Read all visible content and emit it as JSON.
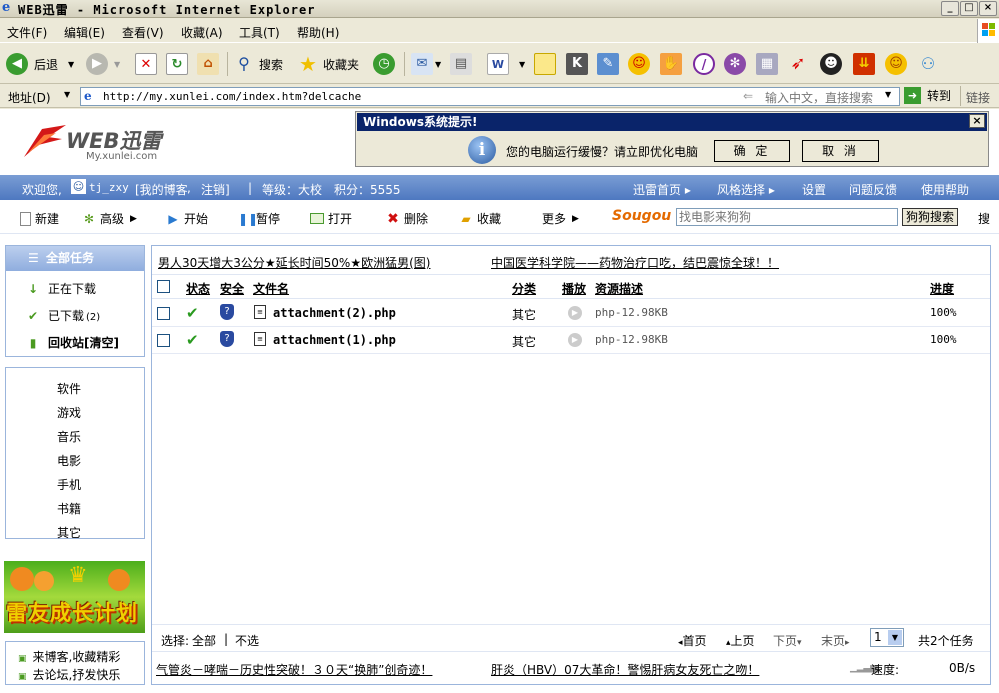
{
  "window": {
    "title": "WEB迅雷 - Microsoft Internet Explorer",
    "min": "_",
    "max": "□",
    "close": "×"
  },
  "menu": [
    "文件(F)",
    "编辑(E)",
    "查看(V)",
    "收藏(A)",
    "工具(T)",
    "帮助(H)"
  ],
  "toolbar": {
    "back": "后退",
    "search": "搜索",
    "favorites": "收藏夹"
  },
  "address": {
    "label": "地址(D)",
    "url": "http://my.xunlei.com/index.htm?delcache",
    "hint": "输入中文，直接搜索",
    "go": "转到",
    "links": "链接"
  },
  "logo": {
    "brand": "WEB迅雷",
    "domain": "My.xunlei.com"
  },
  "alert": {
    "title": "Windows系统提示!",
    "message": "您的电脑运行缓慢？请立即优化电脑",
    "ok": "确 定",
    "cancel": "取 消",
    "close": "×"
  },
  "userbar": {
    "welcome": "欢迎您,",
    "user": "tj_zxy",
    "blog": "[我的博客",
    "logout": "注销]",
    "level": "等级：大校",
    "points": "积分：5555",
    "home": "迅雷首页",
    "style": "风格选择",
    "settings": "设置",
    "feedback": "问题反馈",
    "help": "使用帮助"
  },
  "actions": {
    "new": "新建",
    "advanced": "高级",
    "start": "开始",
    "pause": "暂停",
    "open": "打开",
    "delete": "删除",
    "favorite": "收藏",
    "more": "更多",
    "search_placeholder": "找电影来狗狗",
    "search_button": "狗狗搜索",
    "search_more": "搜"
  },
  "sogou": "Sougou",
  "left": {
    "all_tasks": "全部任务",
    "downloading": "正在下载",
    "downloaded": "已下载",
    "downloaded_count": "(2)",
    "recycle": "回收站[清空]"
  },
  "categories": [
    "软件",
    "游戏",
    "音乐",
    "电影",
    "手机",
    "书籍",
    "其它"
  ],
  "banner": "雷友成长计划",
  "links": [
    "来博客,收藏精彩",
    "去论坛,抒发快乐"
  ],
  "top_ads": [
    "男人30天增大3公分★延长时间50%★欧洲猛男(图)",
    "中国医学科学院——药物治疗口吃，结巴震惊全球！！"
  ],
  "table": {
    "headers": {
      "status": "状态",
      "security": "安全",
      "filename": "文件名",
      "category": "分类",
      "play": "播放",
      "source": "资源描述",
      "progress": "进度"
    },
    "rows": [
      {
        "filename": "attachment(2).php",
        "category": "其它",
        "source": "php-12.98KB",
        "progress": "100%"
      },
      {
        "filename": "attachment(1).php",
        "category": "其它",
        "source": "php-12.98KB",
        "progress": "100%"
      }
    ]
  },
  "pager": {
    "select": "选择:",
    "all": "全部",
    "none": "不选",
    "first": "首页",
    "prev": "上页",
    "next": "下页",
    "last": "末页",
    "page": "1",
    "total": "共2个任务"
  },
  "bottom_ads": [
    "气管炎－哮喘－历史性突破！３０天“换肺”创奇迹！",
    "肝炎（HBV）07大革命！警惕肝病女友死亡之吻！"
  ],
  "status": {
    "speed_label": "速度:",
    "speed": "0B/s"
  }
}
